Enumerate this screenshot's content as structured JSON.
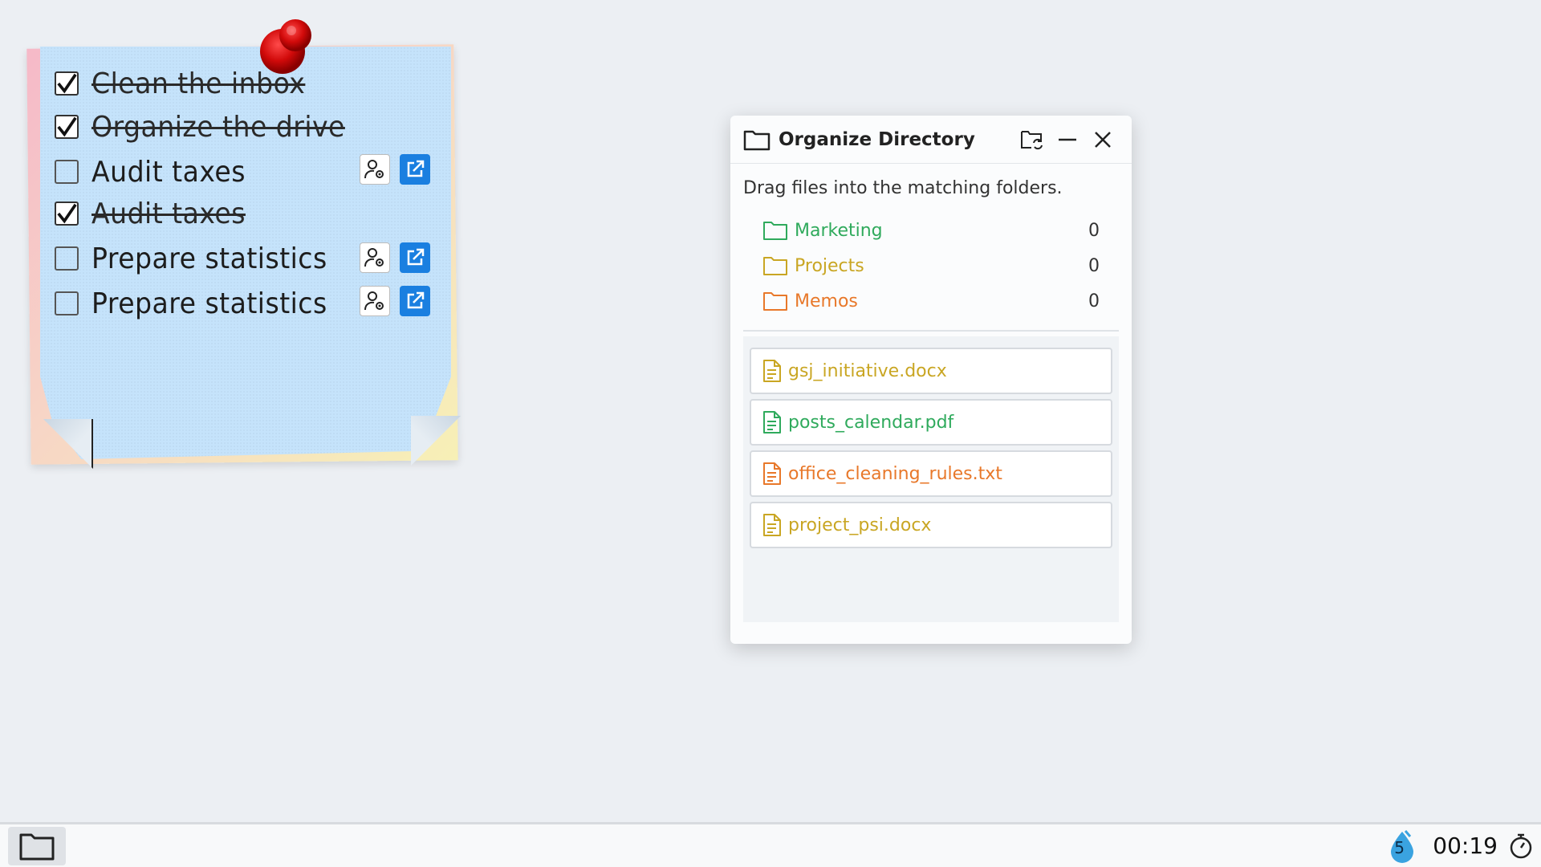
{
  "sticky_note": {
    "tasks": [
      {
        "label": "Clean the inbox",
        "done": true
      },
      {
        "label": "Organize the drive",
        "done": true
      },
      {
        "label": "Audit taxes",
        "done": false
      },
      {
        "label": "Audit taxes",
        "done": true
      },
      {
        "label": "Prepare statistics",
        "done": false
      },
      {
        "label": "Prepare statistics",
        "done": false
      }
    ],
    "icons": {
      "assign": "user-gear-icon",
      "open": "external-link-icon",
      "pin": "pushpin-icon"
    }
  },
  "dialog": {
    "title": "Organize Directory",
    "instruction": "Drag files into the matching folders.",
    "folders": [
      {
        "name": "Marketing",
        "count": "0",
        "color": "#2faa5c"
      },
      {
        "name": "Projects",
        "count": "0",
        "color": "#c9a623"
      },
      {
        "name": "Memos",
        "count": "0",
        "color": "#e8782a"
      }
    ],
    "files": [
      {
        "name": "gsj_initiative.docx",
        "color": "#c9a623"
      },
      {
        "name": "posts_calendar.pdf",
        "color": "#2faa5c"
      },
      {
        "name": "office_cleaning_rules.txt",
        "color": "#e8782a"
      },
      {
        "name": "project_psi.docx",
        "color": "#c9a623"
      }
    ]
  },
  "taskbar": {
    "badge_count": "5",
    "timer": "00:19"
  }
}
